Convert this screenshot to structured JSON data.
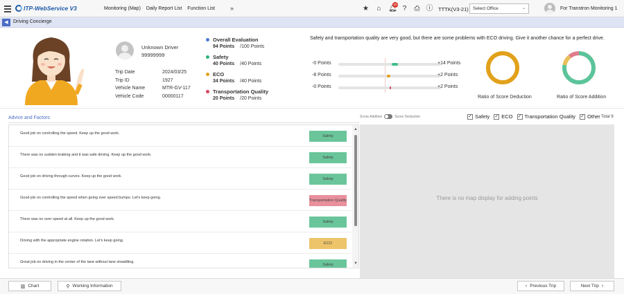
{
  "header": {
    "logo_text": "ITP-WebService V3",
    "menu": [
      "Monitoring (Map)",
      "Daily Report List",
      "Function List"
    ],
    "more": "»",
    "notification_count": "20",
    "company": "TTTK(V3-21)",
    "office_select": "Select Office",
    "user": "For Transtron Monitoring 1"
  },
  "breadcrumb": {
    "title": "Driving Concierge"
  },
  "driver": {
    "name": "Unknown Driver",
    "id": "99999999",
    "trip_date_label": "Trip Date",
    "trip_date": "2024/03/25",
    "trip_id_label": "Trip ID",
    "trip_id": "1927",
    "vehicle_name_label": "Vehicle Name",
    "vehicle_name": "MTR-GV-117",
    "vehicle_code_label": "Vehicle Code",
    "vehicle_code": "00000117"
  },
  "scores": [
    {
      "title": "Overall Evaluation",
      "points": "94 Points",
      "max": "/100 Points",
      "color": "#4a7bd0"
    },
    {
      "title": "Safety",
      "points": "40 Points",
      "max": "/40 Points",
      "color": "#2db37a"
    },
    {
      "title": "ECO",
      "points": "34 Points",
      "max": "/40 Points",
      "color": "#e2a11a"
    },
    {
      "title": "Transportation Quality",
      "points": "20 Points",
      "max": "/20 Points",
      "color": "#d9455f"
    }
  ],
  "message": "Safety and transportation quality are very good, but there are some problems with ECO driving. Give it another chance for a perfect drive.",
  "bars": [
    {
      "left": "-0 Points",
      "right": "+14 Points",
      "color": "#3fbf8a",
      "pos": 0.52,
      "width": 0.06
    },
    {
      "left": "-8 Points",
      "right": "+2 Points",
      "color": "#e2a11a",
      "pos": 0.47,
      "width": 0.04
    },
    {
      "left": "-0 Points",
      "right": "+2 Points",
      "color": "#d9455f",
      "pos": 0.5,
      "width": 0.01
    }
  ],
  "rings": {
    "deduction_label": "Ratio of Score Deduction",
    "addition_label": "Ratio of Score Addition",
    "deduction": [
      {
        "value": 1.0,
        "color": "#e2a11a"
      }
    ],
    "addition": [
      {
        "value": 0.78,
        "color": "#5cc49a"
      },
      {
        "value": 0.11,
        "color": "#e8c15a"
      },
      {
        "value": 0.11,
        "color": "#e07c8c"
      }
    ]
  },
  "advice": {
    "title": "Advice and Factors",
    "toggle_left": "Score Addition",
    "toggle_right": "Score Deduction",
    "filters": [
      "Safety",
      "ECO",
      "Transportation Quality",
      "Other"
    ],
    "total": "Total 9",
    "rows": [
      {
        "text": "Good job on controlling the speed. Keep up the good work.",
        "tag": "Safety",
        "type": "safety"
      },
      {
        "text": "There was no sudden braking and it was safe driving. Keep up the good work.",
        "tag": "Safety",
        "type": "safety"
      },
      {
        "text": "Good job on driving through curves. Keep up the good work.",
        "tag": "Safety",
        "type": "safety"
      },
      {
        "text": "Good job on controlling the speed when going over speed bumps. Let's keep going.",
        "tag": "Transportation Quality",
        "type": "transport"
      },
      {
        "text": "There was no over speed at all. Keep up the good work.",
        "tag": "Safety",
        "type": "safety"
      },
      {
        "text": "Driving with the appropriate engine rotation. Let's keep going.",
        "tag": "ECO",
        "type": "eco"
      },
      {
        "text": "Great job on driving in the center of the lane without lane straddling.",
        "tag": "Safety",
        "type": "safety"
      }
    ]
  },
  "map": {
    "message": "There is no map display for adding points"
  },
  "footer": {
    "chart": "Chart",
    "working_info": "Working Information",
    "prev": "Previous Trip",
    "next": "Next Trip"
  }
}
